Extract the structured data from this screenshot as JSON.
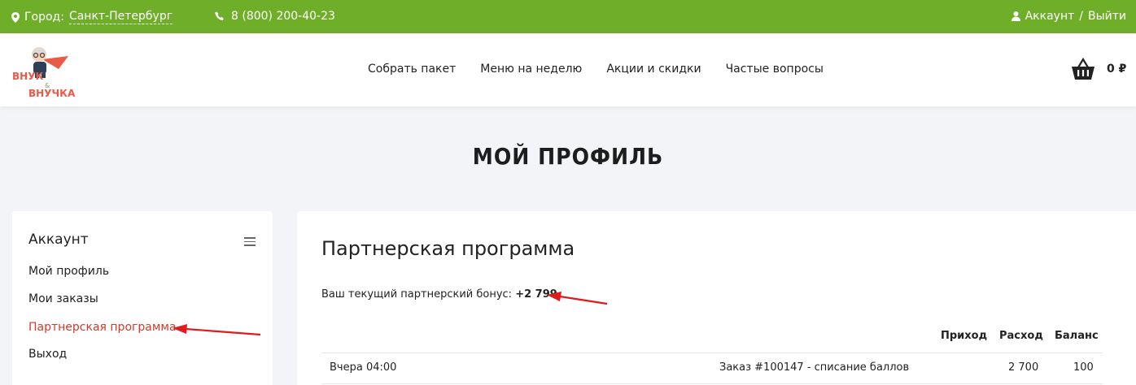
{
  "topbar": {
    "city_label": "Город:",
    "city_value": "Санкт-Петербург",
    "phone": "8 (800) 200-40-23",
    "account": "Аккаунт",
    "separator": "/",
    "logout": "Выйти"
  },
  "header": {
    "logo_text_1": "ВНУК",
    "logo_amp": "&",
    "logo_text_2": "ВНУЧКА",
    "nav": [
      "Собрать пакет",
      "Меню на неделю",
      "Акции и скидки",
      "Частые вопросы"
    ],
    "cart_total": "0 ₽"
  },
  "page": {
    "title": "МОЙ ПРОФИЛЬ"
  },
  "sidebar": {
    "title": "Аккаунт",
    "items": [
      {
        "label": "Мой профиль",
        "active": false
      },
      {
        "label": "Мои заказы",
        "active": false
      },
      {
        "label": "Партнерская программа",
        "active": true
      },
      {
        "label": "Выход",
        "active": false
      }
    ]
  },
  "main": {
    "heading": "Партнерская программа",
    "bonus_label": "Ваш текущий партнерский бонус:",
    "bonus_value": "+2 799",
    "table": {
      "headers": [
        "Приход",
        "Расход",
        "Баланс"
      ],
      "rows": [
        {
          "date": "Вчера 04:00",
          "description": "Заказ #100147 - списание баллов",
          "income": "",
          "expense": "2 700",
          "balance": "100"
        }
      ]
    }
  },
  "colors": {
    "green": "#6fae29",
    "accent_red": "#d23b2b",
    "annotation_arrow": "#e01b1b"
  }
}
